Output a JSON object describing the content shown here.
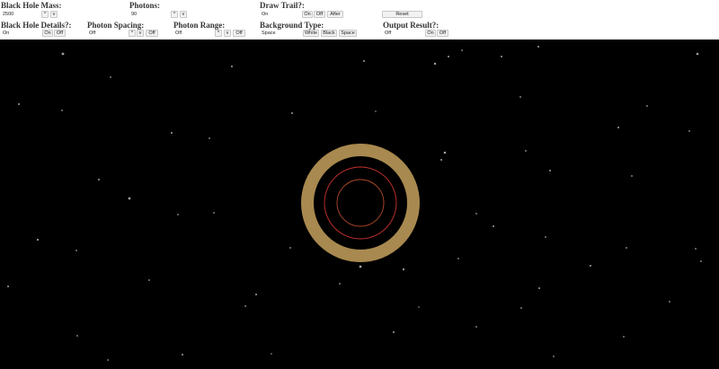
{
  "controls": {
    "mass": {
      "label": "Black Hole Mass:",
      "value": "2500",
      "up": "^",
      "down": "v"
    },
    "photons": {
      "label": "Photons:",
      "value": "90",
      "up": "^",
      "down": "v"
    },
    "trail": {
      "label": "Draw Trail?:",
      "value": "On",
      "on": "On",
      "off": "Off",
      "after": "After"
    },
    "reset": {
      "label": "Reset"
    },
    "details": {
      "label": "Black Hole Details?:",
      "value": "On",
      "on": "On",
      "off": "Off"
    },
    "spacing": {
      "label": "Photon Spacing:",
      "value": "Off",
      "up": "^",
      "down": "v",
      "off": "Off"
    },
    "range": {
      "label": "Photon Range:",
      "value": "Off",
      "up": "^",
      "down": "v",
      "off": "Off"
    },
    "background": {
      "label": "Background Type:",
      "value": "Space",
      "white": "White",
      "black": "Black",
      "space": "Space"
    },
    "output": {
      "label": "Output Result?:",
      "value": "Off",
      "on": "On",
      "off": "Off"
    }
  },
  "simulation": {
    "background": "space",
    "colors": {
      "space": "#000000",
      "photon_ring": "#a8894f",
      "outer_orbit": "#c8322c",
      "inner_orbit": "#b04a2a",
      "star": "#cfd6dc"
    }
  }
}
